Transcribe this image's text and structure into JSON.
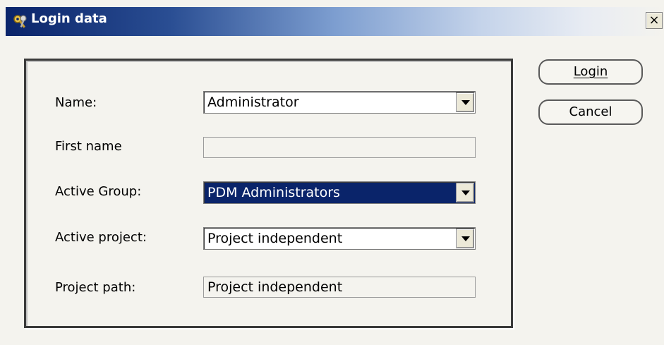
{
  "window": {
    "title": "Login data",
    "close_label": "×"
  },
  "buttons": {
    "login": "Login",
    "cancel": "Cancel"
  },
  "form": {
    "name_label": "Name:",
    "name_value": "Administrator",
    "first_name_label": "First name",
    "first_name_value": "",
    "active_group_label": "Active Group:",
    "active_group_value": "PDM Administrators",
    "active_project_label": "Active project:",
    "active_project_value": "Project independent",
    "project_path_label": "Project path:",
    "project_path_value": "Project independent"
  },
  "icons": {
    "title_icon": "keys-icon",
    "close": "close-icon",
    "dropdown": "chevron-down-icon"
  }
}
